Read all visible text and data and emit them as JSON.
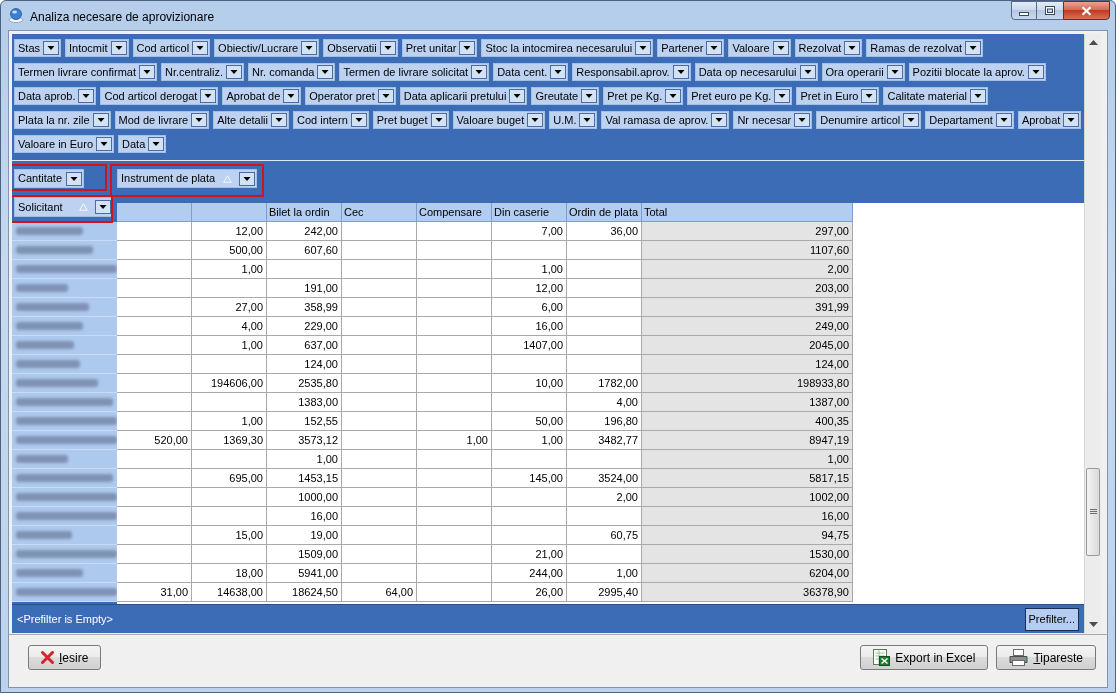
{
  "window": {
    "title": "Analiza necesare de aprovizionare"
  },
  "filter_area": {
    "rows": [
      {
        "fields": [
          "Stas",
          "Intocmit",
          "Cod articol",
          "Obiectiv/Lucrare",
          "Observatii",
          "Pret unitar",
          "Stoc la intocmirea necesarului",
          "Partener",
          "Valoare",
          "Rezolvat",
          "Ramas de rezolvat"
        ]
      },
      {
        "fields": [
          "Termen livrare confirmat",
          "Nr.centraliz.",
          "Nr. comanda",
          "Termen de livrare solicitat",
          "Data cent.",
          "Responsabil.aprov.",
          "Data op necesarului",
          "Ora operarii",
          "Pozitii blocate la aprov."
        ]
      },
      {
        "fields": [
          "Data aprob.",
          "Cod articol derogat",
          "Aprobat de",
          "Operator pret",
          "Data aplicarii pretului",
          "Greutate",
          "Pret pe Kg.",
          "Pret euro pe Kg.",
          "Pret in Euro",
          "Calitate material"
        ]
      },
      {
        "fields": [
          "Plata la nr. zile",
          "Mod de livrare",
          "Alte detalii",
          "Cod intern",
          "Pret buget",
          "Valoare buget",
          "U.M.",
          "Val ramasa de aprov.",
          "Nr necesar",
          "Denumire articol",
          "Departament",
          "Aprobat"
        ]
      },
      {
        "fields": [
          "Valoare in Euro",
          "Data"
        ]
      }
    ]
  },
  "data_area": {
    "fields": [
      {
        "label": "Cantitate",
        "sorted": false,
        "highlighted": true
      }
    ]
  },
  "column_area": {
    "fields": [
      {
        "label": "Instrument de plata",
        "sorted": true,
        "highlighted": true
      }
    ]
  },
  "row_area": {
    "fields": [
      {
        "label": "Solicitant",
        "sorted": true,
        "highlighted": true
      }
    ]
  },
  "table": {
    "columns": [
      {
        "kind": "value"
      },
      {
        "kind": "value"
      },
      {
        "kind": "value",
        "label": "Bilet la ordin"
      },
      {
        "kind": "value",
        "label": "Cec"
      },
      {
        "kind": "value",
        "label": "Compensare"
      },
      {
        "kind": "value",
        "label": "Din caserie"
      },
      {
        "kind": "value",
        "label": "Ordin de plata"
      },
      {
        "kind": "total",
        "label": "Total"
      }
    ],
    "rows": [
      {
        "cells": [
          null,
          "12,00",
          "242,00",
          null,
          null,
          "7,00",
          "36,00",
          "297,00"
        ]
      },
      {
        "cells": [
          null,
          "500,00",
          "607,60",
          null,
          null,
          null,
          null,
          "1107,60"
        ]
      },
      {
        "cells": [
          null,
          "1,00",
          null,
          null,
          null,
          "1,00",
          null,
          "2,00"
        ]
      },
      {
        "cells": [
          null,
          null,
          "191,00",
          null,
          null,
          "12,00",
          null,
          "203,00"
        ]
      },
      {
        "cells": [
          null,
          "27,00",
          "358,99",
          null,
          null,
          "6,00",
          null,
          "391,99"
        ]
      },
      {
        "cells": [
          null,
          "4,00",
          "229,00",
          null,
          null,
          "16,00",
          null,
          "249,00"
        ]
      },
      {
        "cells": [
          null,
          "1,00",
          "637,00",
          null,
          null,
          "1407,00",
          null,
          "2045,00"
        ]
      },
      {
        "cells": [
          null,
          null,
          "124,00",
          null,
          null,
          null,
          null,
          "124,00"
        ]
      },
      {
        "cells": [
          null,
          "194606,00",
          "2535,80",
          null,
          null,
          "10,00",
          "1782,00",
          "198933,80"
        ]
      },
      {
        "cells": [
          null,
          null,
          "1383,00",
          null,
          null,
          null,
          "4,00",
          "1387,00"
        ]
      },
      {
        "cells": [
          null,
          "1,00",
          "152,55",
          null,
          null,
          "50,00",
          "196,80",
          "400,35"
        ]
      },
      {
        "cells": [
          "520,00",
          "1369,30",
          "3573,12",
          null,
          "1,00",
          "1,00",
          "3482,77",
          "8947,19"
        ]
      },
      {
        "cells": [
          null,
          null,
          "1,00",
          null,
          null,
          null,
          null,
          "1,00"
        ]
      },
      {
        "cells": [
          null,
          "695,00",
          "1453,15",
          null,
          null,
          "145,00",
          "3524,00",
          "5817,15"
        ]
      },
      {
        "cells": [
          null,
          null,
          "1000,00",
          null,
          null,
          null,
          "2,00",
          "1002,00"
        ]
      },
      {
        "cells": [
          null,
          null,
          "16,00",
          null,
          null,
          null,
          null,
          "16,00"
        ]
      },
      {
        "cells": [
          null,
          "15,00",
          "19,00",
          null,
          null,
          null,
          "60,75",
          "94,75"
        ]
      },
      {
        "cells": [
          null,
          null,
          "1509,00",
          null,
          null,
          "21,00",
          null,
          "1530,00"
        ]
      },
      {
        "cells": [
          null,
          "18,00",
          "5941,00",
          null,
          null,
          "244,00",
          "1,00",
          "6204,00"
        ]
      },
      {
        "cells": [
          "31,00",
          "14638,00",
          "18624,50",
          "64,00",
          null,
          "26,00",
          "2995,40",
          "36378,90"
        ]
      }
    ]
  },
  "prefilter": {
    "text": "<Prefilter is Empty>",
    "button": "Prefilter..."
  },
  "buttons": [
    {
      "label": "Iesire",
      "kind": "close",
      "access_key_underlined": true
    },
    {
      "label": "Export in Excel",
      "kind": "excel",
      "access_key_underlined": false
    },
    {
      "label": "Tipareste",
      "kind": "print",
      "access_key_underlined": true
    }
  ]
}
